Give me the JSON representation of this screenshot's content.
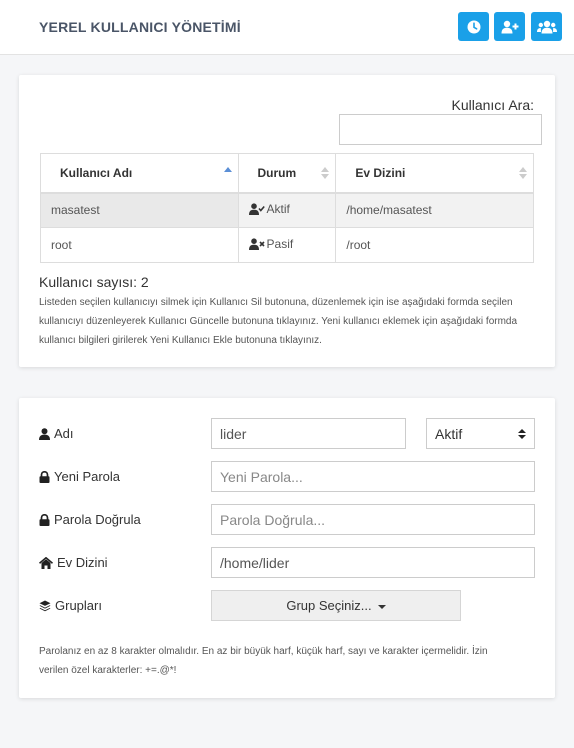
{
  "header": {
    "title": "YEREL KULLANICI YÖNETİMİ",
    "buttons": [
      {
        "icon": "clock-icon"
      },
      {
        "icon": "add-user-icon"
      },
      {
        "icon": "users-icon"
      }
    ],
    "accent_color": "#1aa0e8"
  },
  "user_list": {
    "search_label": "Kullanıcı Ara:",
    "search_value": "",
    "columns": [
      "Kullanıcı Adı",
      "Durum",
      "Ev Dizini"
    ],
    "sorted_column": "Kullanıcı Adı",
    "rows": [
      {
        "name": "masatest",
        "status": "Aktif",
        "status_icon": "user-check-icon",
        "home": "/home/masatest"
      },
      {
        "name": "root",
        "status": "Pasif",
        "status_icon": "user-times-icon",
        "home": "/root"
      }
    ],
    "count_text": "Kullanıcı sayısı: 2",
    "help_text": "Listeden seçilen kullanıcıyı silmek için Kullanıcı Sil butonuna, düzenlemek için ise aşağıdaki formda seçilen kullanıcıyı düzenleyerek Kullanıcı Güncelle butonuna tıklayınız. Yeni kullanıcı eklemek için aşağıdaki formda kullanıcı bilgileri girilerek Yeni Kullanıcı Ekle butonuna tıklayınız."
  },
  "form": {
    "name_label": "Adı",
    "name_value": "lider",
    "status_value": "Aktif",
    "new_password_label": "Yeni Parola",
    "new_password_placeholder": "Yeni Parola...",
    "confirm_password_label": "Parola Doğrula",
    "confirm_password_placeholder": "Parola Doğrula...",
    "home_label": "Ev Dizini",
    "home_value": "/home/lider",
    "groups_label": "Grupları",
    "groups_button": "Grup Seçiniz...",
    "password_help": "Parolanız en az 8 karakter olmalıdır. En az bir büyük harf, küçük harf, sayı ve karakter içermelidir. İzin verilen özel karakterler: +=.@*!"
  }
}
